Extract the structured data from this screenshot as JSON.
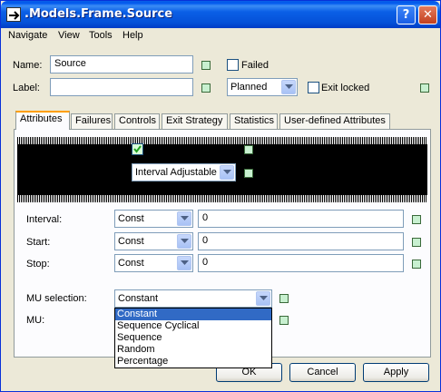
{
  "window": {
    "title": ".Models.Frame.Source"
  },
  "titlebar_buttons": {
    "help": "?",
    "close": "✕"
  },
  "menu": [
    "Navigate",
    "View",
    "Tools",
    "Help"
  ],
  "form": {
    "name_label": "Name:",
    "name_value": "Source",
    "label_label": "Label:",
    "label_value": "",
    "failed_label": "Failed",
    "status_value": "Planned",
    "exit_locked_label": "Exit locked"
  },
  "tabs": [
    "Attributes",
    "Failures",
    "Controls",
    "Exit Strategy",
    "Statistics",
    "User-defined Attributes"
  ],
  "attributes": {
    "operation_mode_value": "Interval Adjustable",
    "rows": [
      {
        "label": "Interval:",
        "dist": "Const",
        "value": "0"
      },
      {
        "label": "Start:",
        "dist": "Const",
        "value": "0"
      },
      {
        "label": "Stop:",
        "dist": "Const",
        "value": "0"
      }
    ],
    "mu_selection_label": "MU selection:",
    "mu_selection_value": "Constant",
    "mu_label": "MU:",
    "mu_selection_options": [
      "Constant",
      "Sequence Cyclical",
      "Sequence",
      "Random",
      "Percentage"
    ]
  },
  "buttons": {
    "ok": "OK",
    "cancel": "Cancel",
    "apply": "Apply"
  },
  "colors": {
    "titlebar": "#0a5fe6",
    "selection": "#316ac5",
    "tab_accent": "#ff9f00",
    "indicator": "#c8f0d0"
  }
}
